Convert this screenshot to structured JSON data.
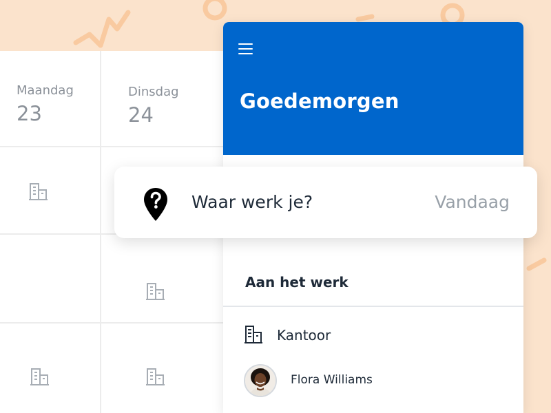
{
  "calendar": {
    "days": [
      {
        "name": "Maandag",
        "date": "23"
      },
      {
        "name": "Dinsdag",
        "date": "24"
      }
    ]
  },
  "header": {
    "greeting": "Goedemorgen"
  },
  "question": {
    "text": "Waar werk je?",
    "date_label": "Vandaag"
  },
  "section": {
    "title": "Aan het werk"
  },
  "location": {
    "label": "Kantoor",
    "icon": "building-icon"
  },
  "person": {
    "name": "Flora Williams"
  },
  "colors": {
    "background": "#fbe3cc",
    "decoration": "#f9caa0",
    "header_blue": "#0066cc",
    "text_dark": "#1e2a38",
    "text_muted": "#98a0a8"
  }
}
